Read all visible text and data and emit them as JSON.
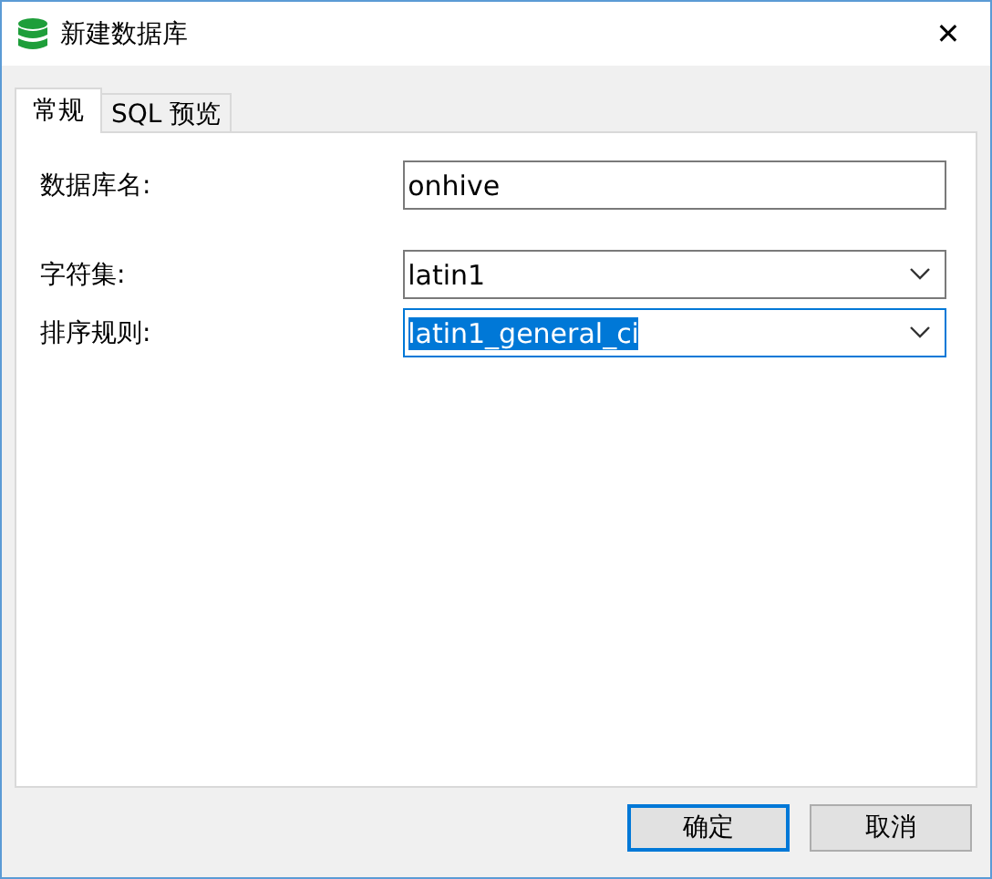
{
  "window": {
    "title": "新建数据库",
    "close": "✕"
  },
  "tabs": [
    {
      "label": "常规",
      "selected": true
    },
    {
      "label": "SQL 预览",
      "selected": false
    }
  ],
  "fields": [
    {
      "label": "数据库名:",
      "kind": "text",
      "value": "onhive",
      "focused": false
    },
    {
      "label": "字符集:",
      "kind": "select",
      "value": "latin1",
      "focused": false
    },
    {
      "label": "排序规则:",
      "kind": "select",
      "value": "latin1_general_ci",
      "focused": true
    }
  ],
  "buttons": [
    {
      "label": "确定",
      "default": true
    },
    {
      "label": "取消",
      "default": false
    }
  ]
}
